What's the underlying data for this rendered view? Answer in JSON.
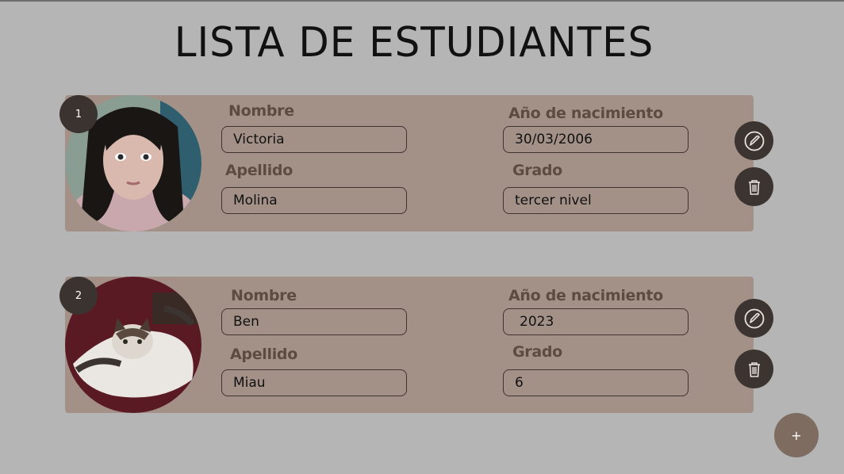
{
  "page": {
    "title": "LISTA DE ESTUDIANTES"
  },
  "labels": {
    "nombre": "Nombre",
    "apellido": "Apellido",
    "nacimiento": "Año de nacimiento",
    "grado": "Grado"
  },
  "students": [
    {
      "index": "1",
      "nombre": "Victoria",
      "apellido": "Molina",
      "nacimiento": "30/03/2006",
      "grado": "tercer nivel"
    },
    {
      "index": "2",
      "nombre": "Ben",
      "apellido": "Miau",
      "nacimiento": "2023",
      "grado": "6"
    }
  ],
  "actions": {
    "add_label": "+"
  },
  "colors": {
    "background": "#b5b5b5",
    "card": "#a39188",
    "label": "#5d4b41",
    "button_dark": "#3b3431",
    "add_button": "#7e6c61"
  },
  "icons": {
    "edit": "pencil-circle-icon",
    "delete": "trash-icon",
    "add": "plus-icon"
  }
}
